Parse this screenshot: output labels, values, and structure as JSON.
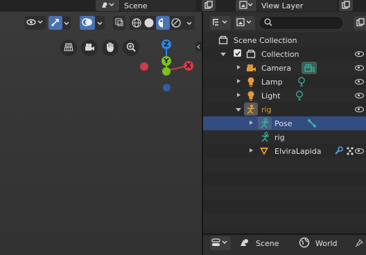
{
  "top": {
    "scene_label": "Scene",
    "view_layer_label": "View Layer"
  },
  "outliner": {
    "rows": [
      {
        "label": "Scene Collection"
      },
      {
        "label": "Collection"
      },
      {
        "label": "Camera"
      },
      {
        "label": "Lamp"
      },
      {
        "label": "Light"
      },
      {
        "label": "rig"
      },
      {
        "label": "Pose"
      },
      {
        "label": "rig"
      },
      {
        "label": "ElviraLapida"
      }
    ]
  },
  "properties": {
    "scene_tab": "Scene",
    "world_tab": "World"
  },
  "gizmo": {
    "z_label": "Z",
    "y_label": "Y",
    "x_label": "X"
  },
  "colors": {
    "selection": "#334d80",
    "accent": "#4772b3",
    "object_orange": "#e39a3a",
    "data_green": "#31b8a3",
    "x_axis": "#d53a4a",
    "y_axis": "#7cc21a",
    "z_axis": "#2f83e5"
  }
}
